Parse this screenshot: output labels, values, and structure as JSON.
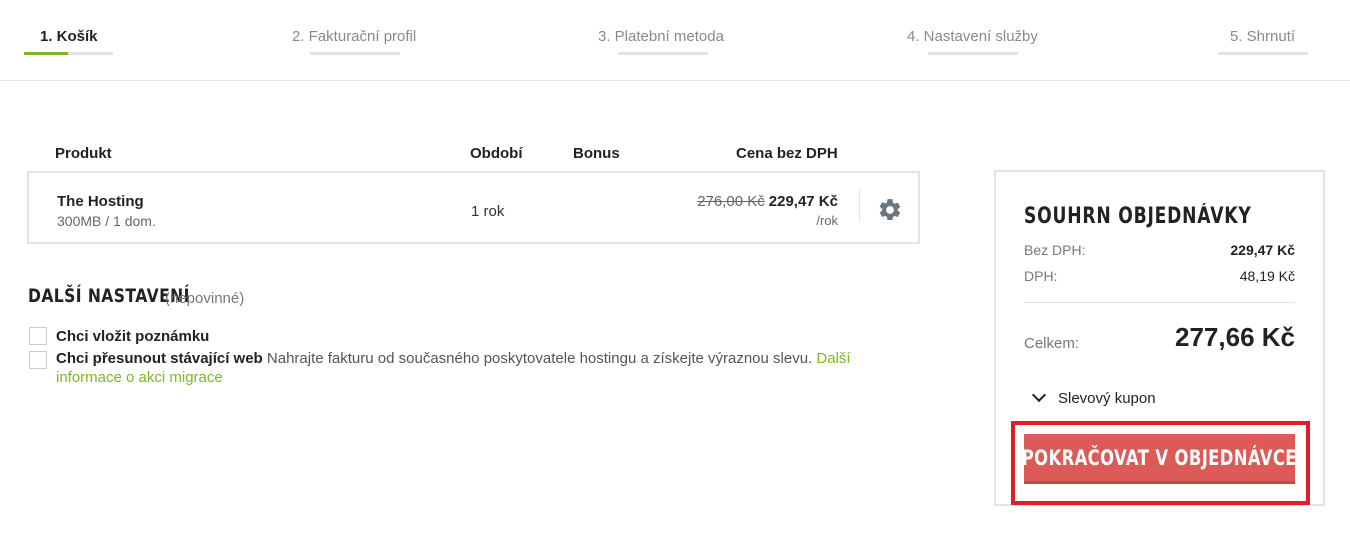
{
  "steps": [
    {
      "label": "1. Košík",
      "active": true
    },
    {
      "label": "2. Fakturační profil",
      "active": false
    },
    {
      "label": "3. Platební metoda",
      "active": false
    },
    {
      "label": "4. Nastavení služby",
      "active": false
    },
    {
      "label": "5. Shrnutí",
      "active": false
    }
  ],
  "cart": {
    "headers": {
      "product": "Produkt",
      "period": "Období",
      "bonus": "Bonus",
      "price": "Cena bez DPH"
    },
    "item": {
      "name": "The Hosting",
      "desc": "300MB / 1 dom.",
      "period": "1 rok",
      "old_price": "276,00 Kč",
      "price": "229,47 Kč",
      "unit": "/rok",
      "settings_icon": "gear-icon"
    }
  },
  "additional": {
    "title": "DALŠÍ NASTAVENÍ",
    "optional": "(nepovinné)",
    "note_label": "Chci vložit poznámku",
    "migrate_label": "Chci přesunout stávající web",
    "migrate_text": "Nahrajte fakturu od současného poskytovatele hostingu a získejte výraznou slevu.",
    "migrate_link": "Další informace o akci migrace"
  },
  "summary": {
    "title": "SOUHRN OBJEDNÁVKY",
    "without_vat_label": "Bez DPH:",
    "without_vat_value": "229,47 Kč",
    "vat_label": "DPH:",
    "vat_value": "48,19 Kč",
    "total_label": "Celkem:",
    "total_value": "277,66 Kč",
    "coupon_label": "Slevový kupon",
    "continue_label": "POKRAČOVAT V OBJEDNÁVCE"
  },
  "colors": {
    "accent": "#7cba21",
    "cta": "#dc5a58",
    "highlight": "#e01e2a"
  }
}
